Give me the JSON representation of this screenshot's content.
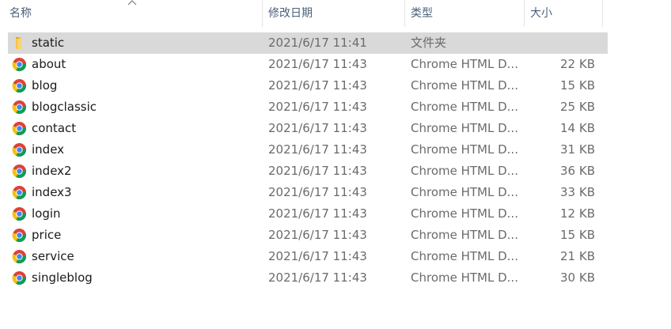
{
  "columns": {
    "name": "名称",
    "date": "修改日期",
    "type": "类型",
    "size": "大小"
  },
  "colors": {
    "selected_row": "#d9d9d9",
    "header_text": "#4c607a",
    "folder": "#f3c447",
    "chrome_red": "#db4437",
    "chrome_yellow": "#f4c20d",
    "chrome_green": "#0f9d58",
    "chrome_blue": "#4285f4"
  },
  "files": [
    {
      "icon": "folder-icon",
      "name": "static",
      "date": "2021/6/17 11:41",
      "type": "文件夹",
      "size": "",
      "selected": true
    },
    {
      "icon": "chrome-icon",
      "name": "about",
      "date": "2021/6/17 11:43",
      "type": "Chrome HTML D...",
      "size": "22 KB"
    },
    {
      "icon": "chrome-icon",
      "name": "blog",
      "date": "2021/6/17 11:43",
      "type": "Chrome HTML D...",
      "size": "15 KB"
    },
    {
      "icon": "chrome-icon",
      "name": "blogclassic",
      "date": "2021/6/17 11:43",
      "type": "Chrome HTML D...",
      "size": "25 KB"
    },
    {
      "icon": "chrome-icon",
      "name": "contact",
      "date": "2021/6/17 11:43",
      "type": "Chrome HTML D...",
      "size": "14 KB"
    },
    {
      "icon": "chrome-icon",
      "name": "index",
      "date": "2021/6/17 11:43",
      "type": "Chrome HTML D...",
      "size": "31 KB"
    },
    {
      "icon": "chrome-icon",
      "name": "index2",
      "date": "2021/6/17 11:43",
      "type": "Chrome HTML D...",
      "size": "36 KB"
    },
    {
      "icon": "chrome-icon",
      "name": "index3",
      "date": "2021/6/17 11:43",
      "type": "Chrome HTML D...",
      "size": "33 KB"
    },
    {
      "icon": "chrome-icon",
      "name": "login",
      "date": "2021/6/17 11:43",
      "type": "Chrome HTML D...",
      "size": "12 KB"
    },
    {
      "icon": "chrome-icon",
      "name": "price",
      "date": "2021/6/17 11:43",
      "type": "Chrome HTML D...",
      "size": "15 KB"
    },
    {
      "icon": "chrome-icon",
      "name": "service",
      "date": "2021/6/17 11:43",
      "type": "Chrome HTML D...",
      "size": "21 KB"
    },
    {
      "icon": "chrome-icon",
      "name": "singleblog",
      "date": "2021/6/17 11:43",
      "type": "Chrome HTML D...",
      "size": "30 KB"
    }
  ]
}
